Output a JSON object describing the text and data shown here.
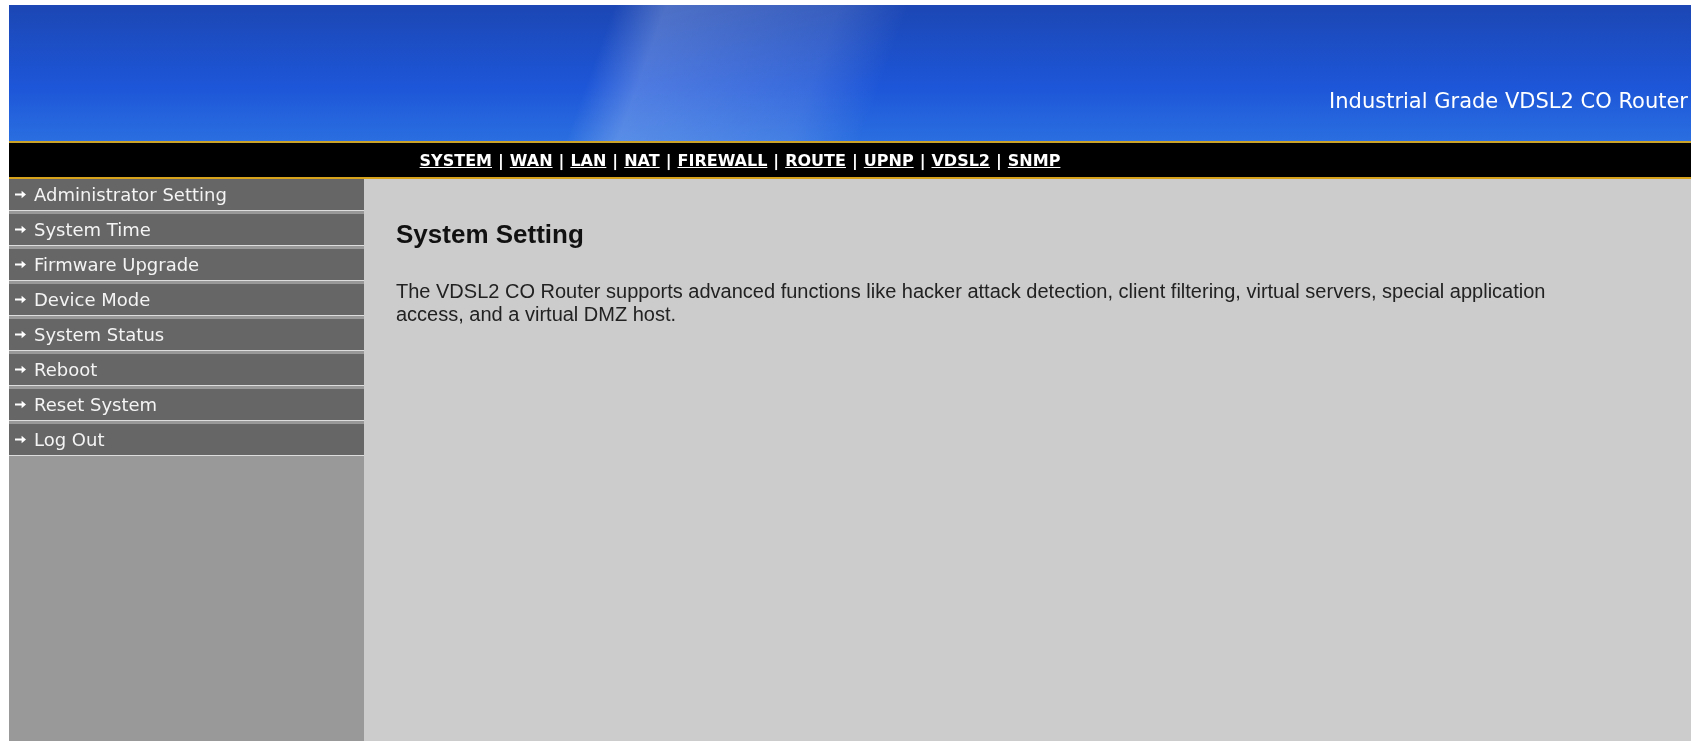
{
  "header": {
    "title": "Industrial Grade VDSL2 CO Router"
  },
  "nav": {
    "separator": "|",
    "items": [
      {
        "label": "SYSTEM"
      },
      {
        "label": "WAN"
      },
      {
        "label": "LAN"
      },
      {
        "label": "NAT"
      },
      {
        "label": "FIREWALL"
      },
      {
        "label": "ROUTE"
      },
      {
        "label": "UPNP"
      },
      {
        "label": "VDSL2"
      },
      {
        "label": "SNMP"
      }
    ]
  },
  "sidebar": {
    "items": [
      {
        "label": "Administrator Setting"
      },
      {
        "label": "System Time"
      },
      {
        "label": "Firmware Upgrade"
      },
      {
        "label": "Device Mode"
      },
      {
        "label": "System Status"
      },
      {
        "label": "Reboot"
      },
      {
        "label": "Reset System"
      },
      {
        "label": "Log Out"
      }
    ]
  },
  "content": {
    "heading": "System Setting",
    "text": "The VDSL2 CO Router supports advanced functions like hacker attack detection, client filtering, virtual servers, special application access, and a virtual DMZ host."
  }
}
